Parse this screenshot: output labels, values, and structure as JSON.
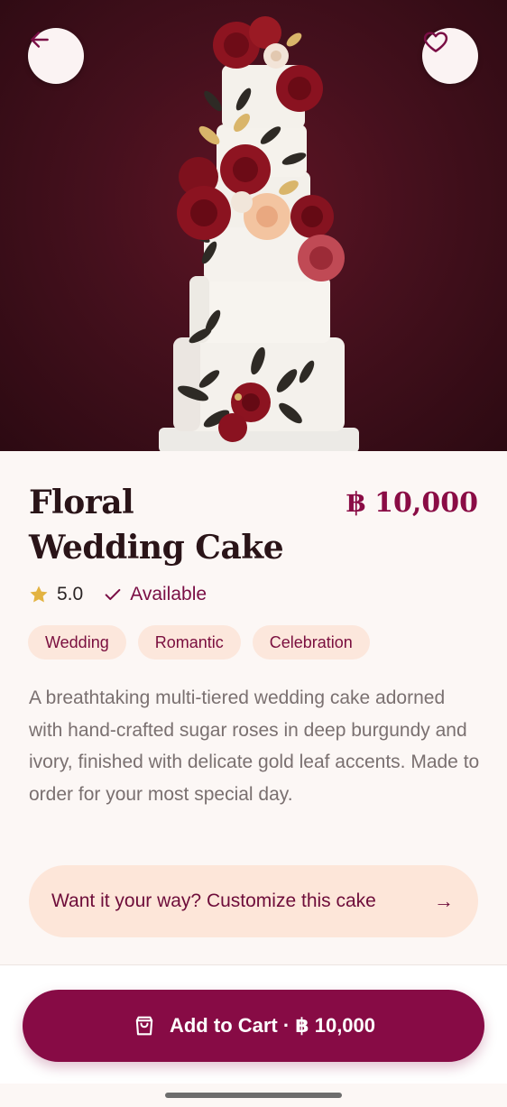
{
  "product": {
    "title": "Floral Wedding Cake",
    "price": "฿ 10,000",
    "rating": "5.0",
    "availability": "Available",
    "tags": [
      "Wedding",
      "Romantic",
      "Celebration"
    ],
    "description": "A breathtaking multi-tiered wedding cake adorned with hand-crafted sugar roses in deep burgundy and ivory, finished with delicate gold leaf accents. Made to order for your most special day."
  },
  "customize": {
    "label": "Want it your way? Customize this cake",
    "arrow": "→"
  },
  "cart": {
    "label": "Add to Cart · ฿ 10,000"
  },
  "icons": {
    "back": "arrow-left-icon",
    "favorite": "heart-icon",
    "rating": "star-icon",
    "availability": "checkmark-icon",
    "cart": "shopping-bag-icon"
  },
  "colors": {
    "brand": "#870b45",
    "accent_text": "#7a0e45",
    "tag_background": "#fce7dc",
    "star": "#e3b341",
    "hero_background": "#45101d"
  }
}
